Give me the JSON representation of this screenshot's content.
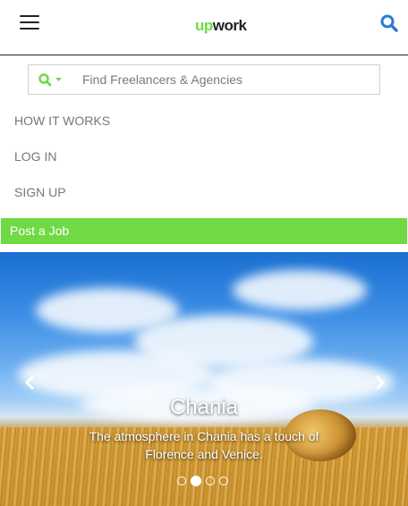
{
  "header": {
    "logo_up": "up",
    "logo_work": "work",
    "accent_color": "#6fda44",
    "search_icon_color": "#2a7bd5"
  },
  "search": {
    "placeholder": "Find Freelancers & Agencies",
    "value": ""
  },
  "nav": {
    "items": [
      {
        "label": "HOW IT WORKS"
      },
      {
        "label": "LOG IN"
      },
      {
        "label": "SIGN UP"
      }
    ],
    "post_job": "Post a Job"
  },
  "carousel": {
    "title": "Chania",
    "text": "The atmosphere in Chania has a touch of Florence and Venice.",
    "slide_count": 4,
    "active_slide": 2,
    "prev_icon": "chevron-left",
    "next_icon": "chevron-right"
  }
}
